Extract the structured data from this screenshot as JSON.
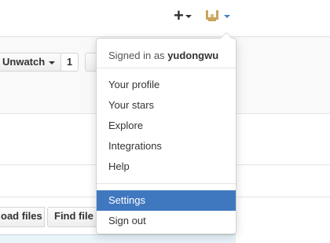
{
  "header": {
    "plus_icon_glyph": "+",
    "create_menu_icon": "plus-icon",
    "avatar_icon": "avatar-icon",
    "caret_color": "#4183c4"
  },
  "repo": {
    "watch_label": "Unwatch",
    "watch_count": "1",
    "upload_label": "oad files",
    "find_label": "Find file"
  },
  "menu": {
    "signed_in_prefix": "Signed in as",
    "username": "yudongwu",
    "items": [
      {
        "label": "Your profile"
      },
      {
        "label": "Your stars"
      },
      {
        "label": "Explore"
      },
      {
        "label": "Integrations"
      },
      {
        "label": "Help"
      }
    ],
    "settings_label": "Settings",
    "signout_label": "Sign out",
    "active_color": "#4078c0"
  }
}
